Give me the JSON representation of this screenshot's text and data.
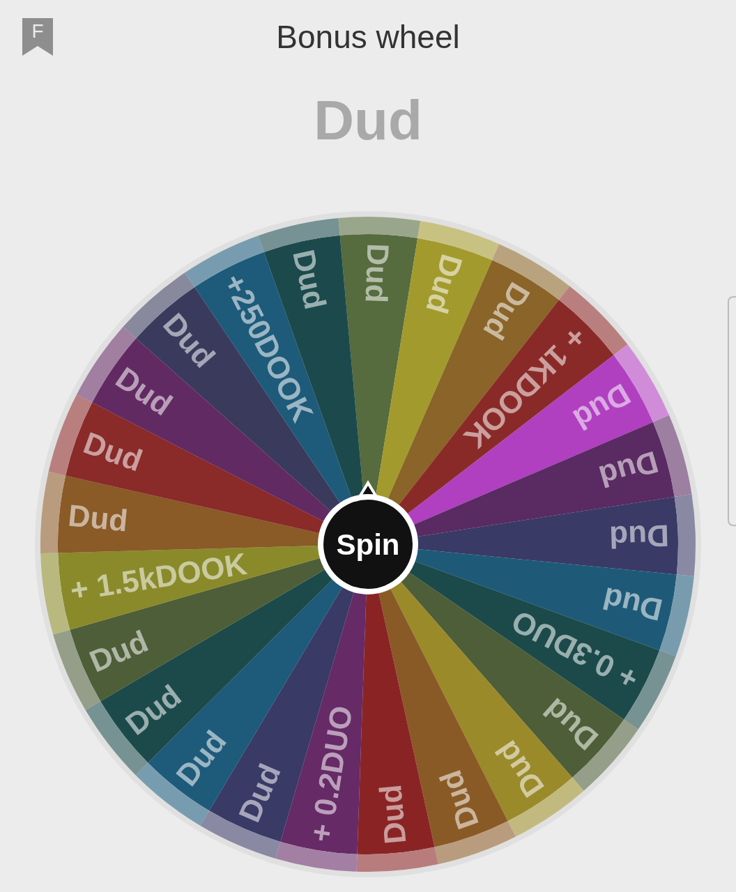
{
  "header": {
    "badge": "F",
    "title": "Bonus wheel"
  },
  "result": "Dud",
  "wheel": {
    "button": "Spin",
    "segments": [
      {
        "label": "Dud",
        "color": "#566b3e"
      },
      {
        "label": "Dud",
        "color": "#a39a2e"
      },
      {
        "label": "Dud",
        "color": "#8a6428"
      },
      {
        "label": "+ 1KDOOK",
        "color": "#8a2a28"
      },
      {
        "label": "Dud",
        "color": "#b040c0"
      },
      {
        "label": "Dud",
        "color": "#5a2a62"
      },
      {
        "label": "Dud",
        "color": "#3a3a66"
      },
      {
        "label": "Dud",
        "color": "#1e5a78"
      },
      {
        "label": "+ 0.3DUO",
        "color": "#1c4a4a"
      },
      {
        "label": "Dud",
        "color": "#4e5e38"
      },
      {
        "label": "Dud",
        "color": "#9a8a2a"
      },
      {
        "label": "Dud",
        "color": "#8a5a26"
      },
      {
        "label": "Dud",
        "color": "#8a2424"
      },
      {
        "label": "+ 0.2DUO",
        "color": "#662a66"
      },
      {
        "label": "Dud",
        "color": "#3a3a67"
      },
      {
        "label": "Dud",
        "color": "#1e5a79"
      },
      {
        "label": "Dud",
        "color": "#1c4a4b"
      },
      {
        "label": "Dud",
        "color": "#4e5e39"
      },
      {
        "label": "+ 1.5kDOOK",
        "color": "#8a8a2a"
      },
      {
        "label": "Dud",
        "color": "#8a5a27"
      },
      {
        "label": "Dud",
        "color": "#8a2a29"
      },
      {
        "label": "Dud",
        "color": "#622a62"
      },
      {
        "label": "Dud",
        "color": "#3a3a5c"
      },
      {
        "label": "+250DOOK",
        "color": "#1e5a7a"
      },
      {
        "label": "Dud",
        "color": "#1c4a4c"
      }
    ]
  }
}
